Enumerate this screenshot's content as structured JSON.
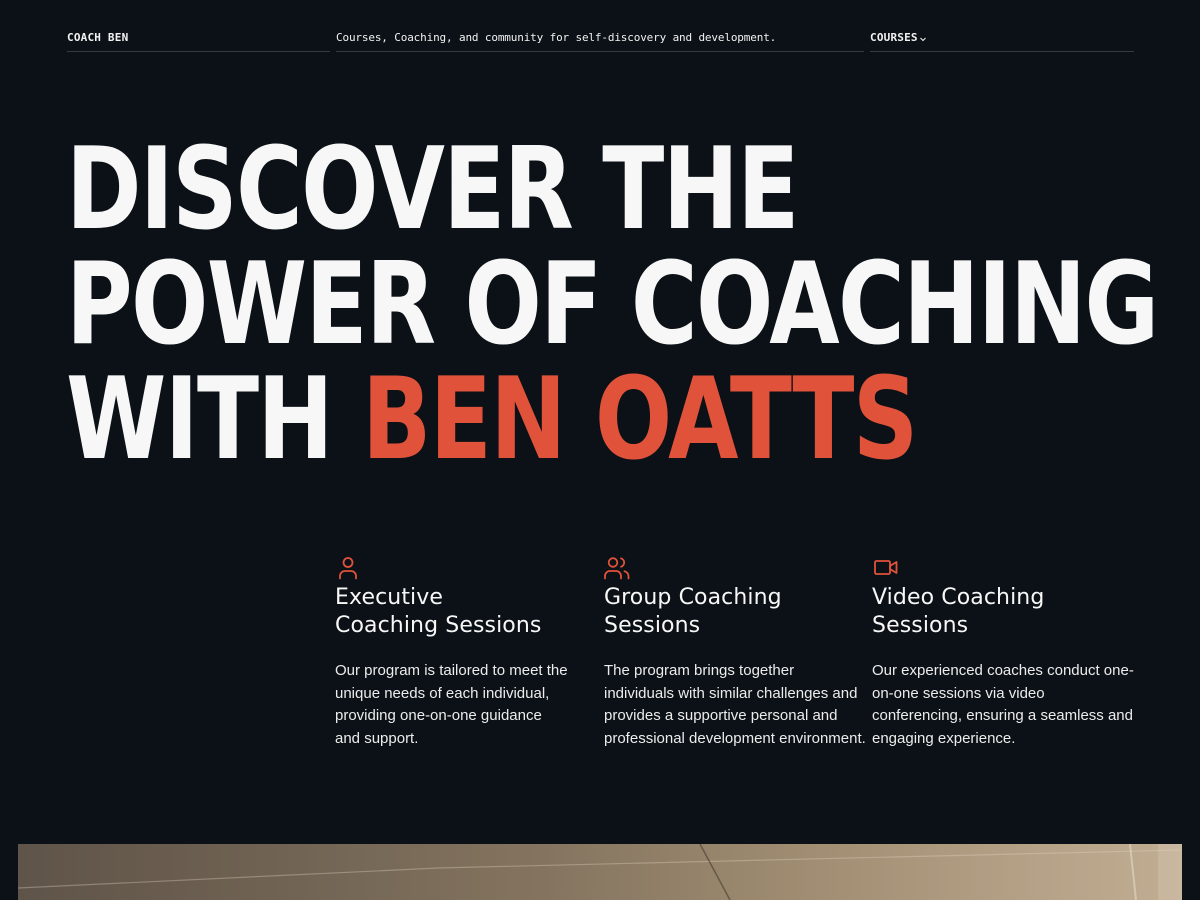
{
  "nav": {
    "brand": "COACH BEN",
    "tagline": "Courses, Coaching, and community for self-discovery and development.",
    "menu": {
      "label": "COURSES",
      "icon": "chevron-down-icon"
    }
  },
  "hero": {
    "line1": "DISCOVER THE",
    "line2": "POWER OF COACHING",
    "line3_prefix": "WITH",
    "line3_accent": "BEN OATTS"
  },
  "colors": {
    "background": "#0b1116",
    "accent": "#e0533a",
    "text": "#f7f7f7",
    "divider": "#343b41"
  },
  "features": [
    {
      "icon": "user-icon",
      "title_lines": [
        "Executive",
        "Coaching Sessions"
      ],
      "desc_lines": [
        "Our program is tailored to meet the",
        "unique needs of each individual,",
        "providing one-on-one guidance",
        "and support."
      ]
    },
    {
      "icon": "users-icon",
      "title_lines": [
        "Group Coaching",
        "Sessions"
      ],
      "desc_lines": [
        "The program brings together",
        "individuals with similar challenges and",
        "provides a supportive personal and",
        "professional development environment."
      ]
    },
    {
      "icon": "video-camera-icon",
      "title_lines": [
        "Video Coaching",
        "Sessions"
      ],
      "desc_lines": [
        "Our experienced coaches conduct one-",
        "on-one sessions via video",
        "conferencing, ensuring a seamless and",
        "engaging experience."
      ]
    }
  ]
}
